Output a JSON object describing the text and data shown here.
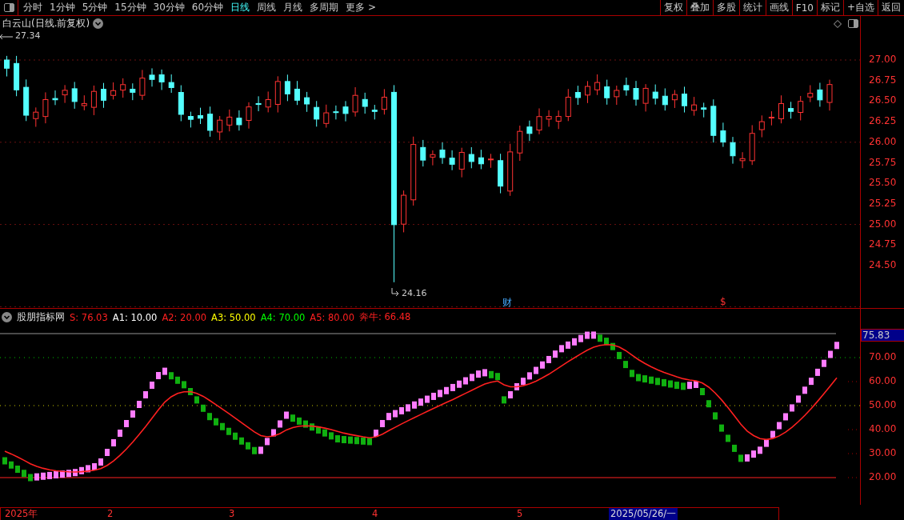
{
  "toolbar": {
    "periods": [
      {
        "label": "分时",
        "selected": false
      },
      {
        "label": "1分钟",
        "selected": false
      },
      {
        "label": "5分钟",
        "selected": false
      },
      {
        "label": "15分钟",
        "selected": false
      },
      {
        "label": "30分钟",
        "selected": false
      },
      {
        "label": "60分钟",
        "selected": false
      },
      {
        "label": "日线",
        "selected": true
      },
      {
        "label": "周线",
        "selected": false
      },
      {
        "label": "月线",
        "selected": false
      },
      {
        "label": "多周期",
        "selected": false
      },
      {
        "label": "更多 >",
        "selected": false
      }
    ],
    "buttons": [
      "复权",
      "叠加",
      "多股",
      "统计",
      "画线",
      "F10",
      "标记",
      "+自选",
      "返回"
    ]
  },
  "chart": {
    "title": "白云山(日线.前复权)",
    "high_label": "27.34",
    "low_label": "24.16",
    "markers": [
      "财",
      "$"
    ],
    "y_ticks": [
      "27.00",
      "26.75",
      "26.50",
      "26.25",
      "26.00",
      "25.75",
      "25.50",
      "25.25",
      "25.00",
      "24.75",
      "24.50"
    ]
  },
  "indicator": {
    "name": "股朋指标网",
    "legend": [
      {
        "text": "S: 76.03",
        "color": "#ff2020"
      },
      {
        "text": "A1: 10.00",
        "color": "#ffffff"
      },
      {
        "text": "A2: 20.00",
        "color": "#ff2020"
      },
      {
        "text": "A3: 50.00",
        "color": "#ffff00"
      },
      {
        "text": "A4: 70.00",
        "color": "#00ff00"
      },
      {
        "text": "A5: 80.00",
        "color": "#ff2020"
      },
      {
        "text": "奔牛: 66.48",
        "color": "#ff2020"
      }
    ],
    "current_value": "75.83",
    "y_ticks": [
      "70.00",
      "60.00",
      "50.00",
      "40.00",
      "30.00",
      "20.00"
    ]
  },
  "time_axis": {
    "labels": [
      "2025年",
      "2",
      "3",
      "4",
      "5"
    ],
    "cursor_date": "2025/05/26/一"
  }
}
